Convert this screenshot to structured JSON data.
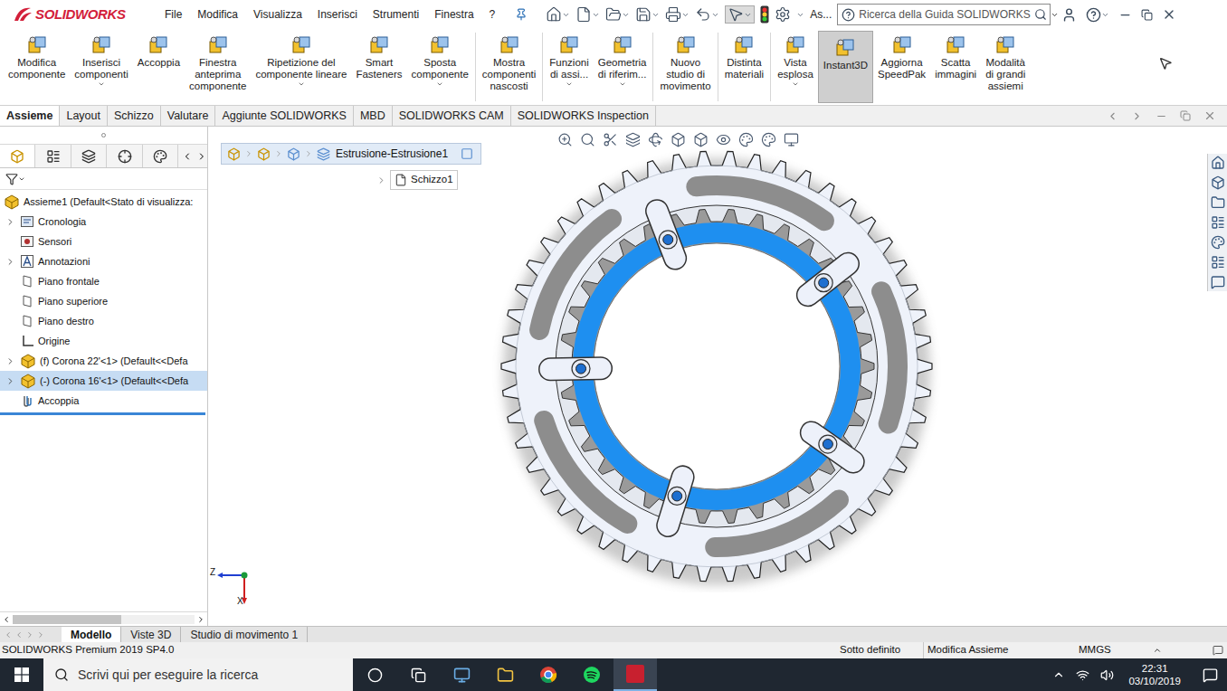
{
  "app": {
    "logo": "SOLIDWORKS"
  },
  "menu": [
    "File",
    "Modifica",
    "Visualizza",
    "Inserisci",
    "Strumenti",
    "Finestra",
    "?"
  ],
  "quick_access_label": "As...",
  "search": {
    "placeholder": "Ricerca della Guida SOLIDWORKS"
  },
  "ribbon": [
    {
      "lines": [
        "Modifica",
        "componente"
      ],
      "dropdown": false,
      "selected": false,
      "group": 1
    },
    {
      "lines": [
        "Inserisci",
        "componenti"
      ],
      "dropdown": true,
      "selected": false,
      "group": 1
    },
    {
      "lines": [
        "Accoppia"
      ],
      "dropdown": false,
      "selected": false,
      "group": 1
    },
    {
      "lines": [
        "Finestra",
        "anteprima",
        "componente"
      ],
      "dropdown": false,
      "selected": false,
      "group": 1
    },
    {
      "lines": [
        "Ripetizione del",
        "componente lineare"
      ],
      "dropdown": true,
      "selected": false,
      "group": 1
    },
    {
      "lines": [
        "Smart",
        "Fasteners"
      ],
      "dropdown": false,
      "selected": false,
      "group": 1
    },
    {
      "lines": [
        "Sposta",
        "componente"
      ],
      "dropdown": true,
      "selected": false,
      "group": 1
    },
    {
      "lines": [
        "Mostra",
        "componenti",
        "nascosti"
      ],
      "dropdown": false,
      "selected": false,
      "group": 2
    },
    {
      "lines": [
        "Funzioni",
        "di assi..."
      ],
      "dropdown": true,
      "selected": false,
      "group": 3
    },
    {
      "lines": [
        "Geometria",
        "di riferim..."
      ],
      "dropdown": true,
      "selected": false,
      "group": 3
    },
    {
      "lines": [
        "Nuovo",
        "studio di",
        "movimento"
      ],
      "dropdown": false,
      "selected": false,
      "group": 4
    },
    {
      "lines": [
        "Distinta",
        "materiali"
      ],
      "dropdown": false,
      "selected": false,
      "group": 5
    },
    {
      "lines": [
        "Vista",
        "esplosa"
      ],
      "dropdown": true,
      "selected": false,
      "group": 6
    },
    {
      "lines": [
        "Instant3D"
      ],
      "dropdown": false,
      "selected": true,
      "group": 6
    },
    {
      "lines": [
        "Aggiorna",
        "SpeedPak"
      ],
      "dropdown": false,
      "selected": false,
      "group": 6
    },
    {
      "lines": [
        "Scatta",
        "immagini"
      ],
      "dropdown": false,
      "selected": false,
      "group": 6
    },
    {
      "lines": [
        "Modalità",
        "di grandi",
        "assiemi"
      ],
      "dropdown": false,
      "selected": false,
      "group": 6
    }
  ],
  "tabs": [
    {
      "label": "Assieme",
      "selected": true
    },
    {
      "label": "Layout",
      "selected": false
    },
    {
      "label": "Schizzo",
      "selected": false
    },
    {
      "label": "Valutare",
      "selected": false
    },
    {
      "label": "Aggiunte SOLIDWORKS",
      "selected": false
    },
    {
      "label": "MBD",
      "selected": false
    },
    {
      "label": "SOLIDWORKS CAM",
      "selected": false
    },
    {
      "label": "SOLIDWORKS Inspection",
      "selected": false
    }
  ],
  "feature_tree": {
    "items": [
      {
        "label": "Assieme1 (Default<Stato di visualizza:",
        "kind": "root",
        "expandable": false,
        "selected": false
      },
      {
        "label": "Cronologia",
        "kind": "folder",
        "expandable": true,
        "selected": false
      },
      {
        "label": "Sensori",
        "kind": "sensor",
        "expandable": false,
        "selected": false
      },
      {
        "label": "Annotazioni",
        "kind": "annotation",
        "expandable": true,
        "selected": false
      },
      {
        "label": "Piano frontale",
        "kind": "plane",
        "expandable": false,
        "selected": false
      },
      {
        "label": "Piano superiore",
        "kind": "plane",
        "expandable": false,
        "selected": false
      },
      {
        "label": "Piano destro",
        "kind": "plane",
        "expandable": false,
        "selected": false
      },
      {
        "label": "Origine",
        "kind": "origin",
        "expandable": false,
        "selected": false
      },
      {
        "label": "(f) Corona 22'<1> (Default<<Defa",
        "kind": "part",
        "expandable": true,
        "selected": false
      },
      {
        "label": "(-) Corona 16'<1> (Default<<Defa",
        "kind": "part",
        "expandable": true,
        "selected": true
      },
      {
        "label": "Accoppia",
        "kind": "mates",
        "expandable": false,
        "selected": false
      }
    ]
  },
  "breadcrumb": {
    "feature": "Estrusione-Estrusione1",
    "sketch": "Schizzo1"
  },
  "triad": {
    "z": "Z",
    "x": "X"
  },
  "bottom_tabs": [
    {
      "label": "Modello",
      "selected": true
    },
    {
      "label": "Viste 3D",
      "selected": false
    },
    {
      "label": "Studio di movimento 1",
      "selected": false
    }
  ],
  "status_bar": {
    "product": "SOLIDWORKS Premium 2019 SP4.0",
    "definition": "Sotto definito",
    "mode": "Modifica Assieme",
    "units": "MMGS"
  },
  "taskbar": {
    "search_placeholder": "Scrivi qui per eseguire la ricerca",
    "time": "22:31",
    "date": "03/10/2019"
  }
}
